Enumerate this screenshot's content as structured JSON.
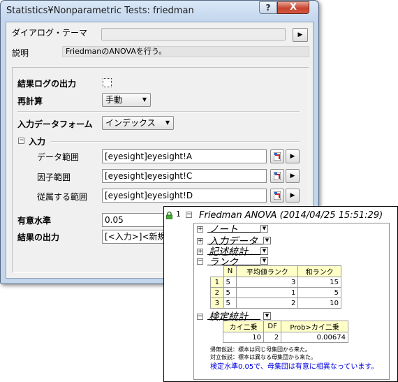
{
  "dialog": {
    "title": "Statistics¥Nonparametric Tests: friedman",
    "help_button": "?",
    "close_button": "X",
    "theme_label": "ダイアログ・テーマ",
    "theme_value": "",
    "desc_label": "説明",
    "desc_value": "FriedmanのANOVAを行う。",
    "log_output_label": "結果ログの出力",
    "recalc_label": "再計算",
    "recalc_value": "手動",
    "input_form_label": "入力データフォーム",
    "input_form_value": "インデックス",
    "input_group_label": "入力",
    "data_range_label": "データ範囲",
    "data_range_value": "[eyesight]eyesight!A",
    "factor_range_label": "因子範囲",
    "factor_range_value": "[eyesight]eyesight!C",
    "dependent_range_label": "従属する範囲",
    "dependent_range_value": "[eyesight]eyesight!D",
    "significance_label": "有意水準",
    "significance_value": "0.05",
    "result_output_label": "結果の出力",
    "result_output_value": "[<入力>]<新規>"
  },
  "report": {
    "row_number": "1",
    "title": "Friedman ANOVA (2014/04/25 15:51:29)",
    "nodes": {
      "notes": "ノート",
      "input_data": "入力データ",
      "descriptive": "記述統計",
      "rank": "ランク",
      "test_stats": "検定統計"
    },
    "rank_table": {
      "headers": [
        "N",
        "平均値ランク",
        "和ランク"
      ],
      "rows": [
        {
          "id": "1",
          "n": "5",
          "mean_rank": "3",
          "sum_rank": "15"
        },
        {
          "id": "2",
          "n": "5",
          "mean_rank": "1",
          "sum_rank": "5"
        },
        {
          "id": "3",
          "n": "5",
          "mean_rank": "2",
          "sum_rank": "10"
        }
      ]
    },
    "test_table": {
      "headers": [
        "カイ二乗",
        "DF",
        "Prob>カイ二乗"
      ],
      "values": [
        "10",
        "2",
        "0.00674"
      ]
    },
    "notes": {
      "null_hypothesis": "帰無仮説：標本は同じ母集団から来た。",
      "alt_hypothesis": "対立仮説：標本は異なる母集団から来た。",
      "conclusion": "検定水準0.05で、母集団は有意に相異なっています。"
    }
  }
}
